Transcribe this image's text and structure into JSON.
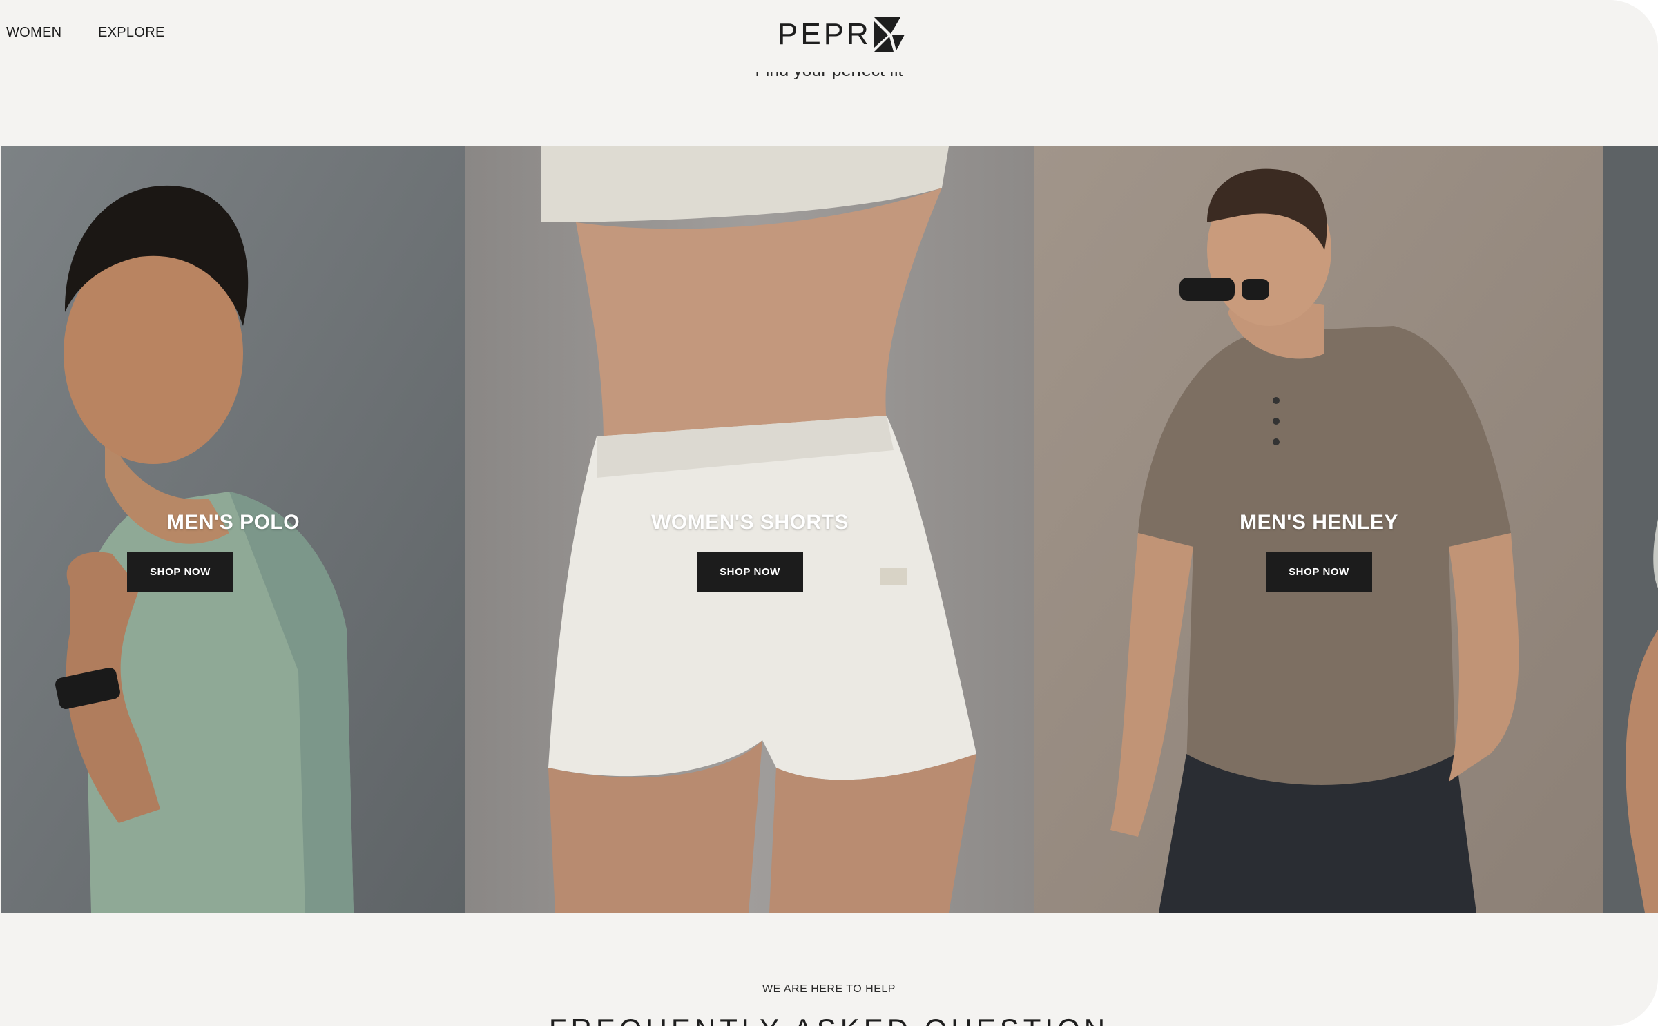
{
  "nav": {
    "women": "WOMEN",
    "explore": "EXPLORE"
  },
  "brand": {
    "name": "PEPR",
    "logo_icon": "pepr-arrow-logo-icon"
  },
  "section": {
    "subtitle": "Find your perfect fit"
  },
  "categories": [
    {
      "title": "MEN'S POLO",
      "button": "SHOP NOW",
      "image": "man-in-sage-polo-photo"
    },
    {
      "title": "WOMEN'S SHORTS",
      "button": "SHOP NOW",
      "image": "woman-in-white-shorts-photo"
    },
    {
      "title": "MEN'S HENLEY",
      "button": "SHOP NOW",
      "image": "man-in-taupe-henley-photo"
    }
  ],
  "faq": {
    "kicker": "WE ARE HERE TO HELP",
    "title": "FREQUENTLY ASKED QUESTION"
  },
  "colors": {
    "background": "#f4f3f1",
    "button": "#1c1c1c",
    "text": "#1e1e1e"
  }
}
